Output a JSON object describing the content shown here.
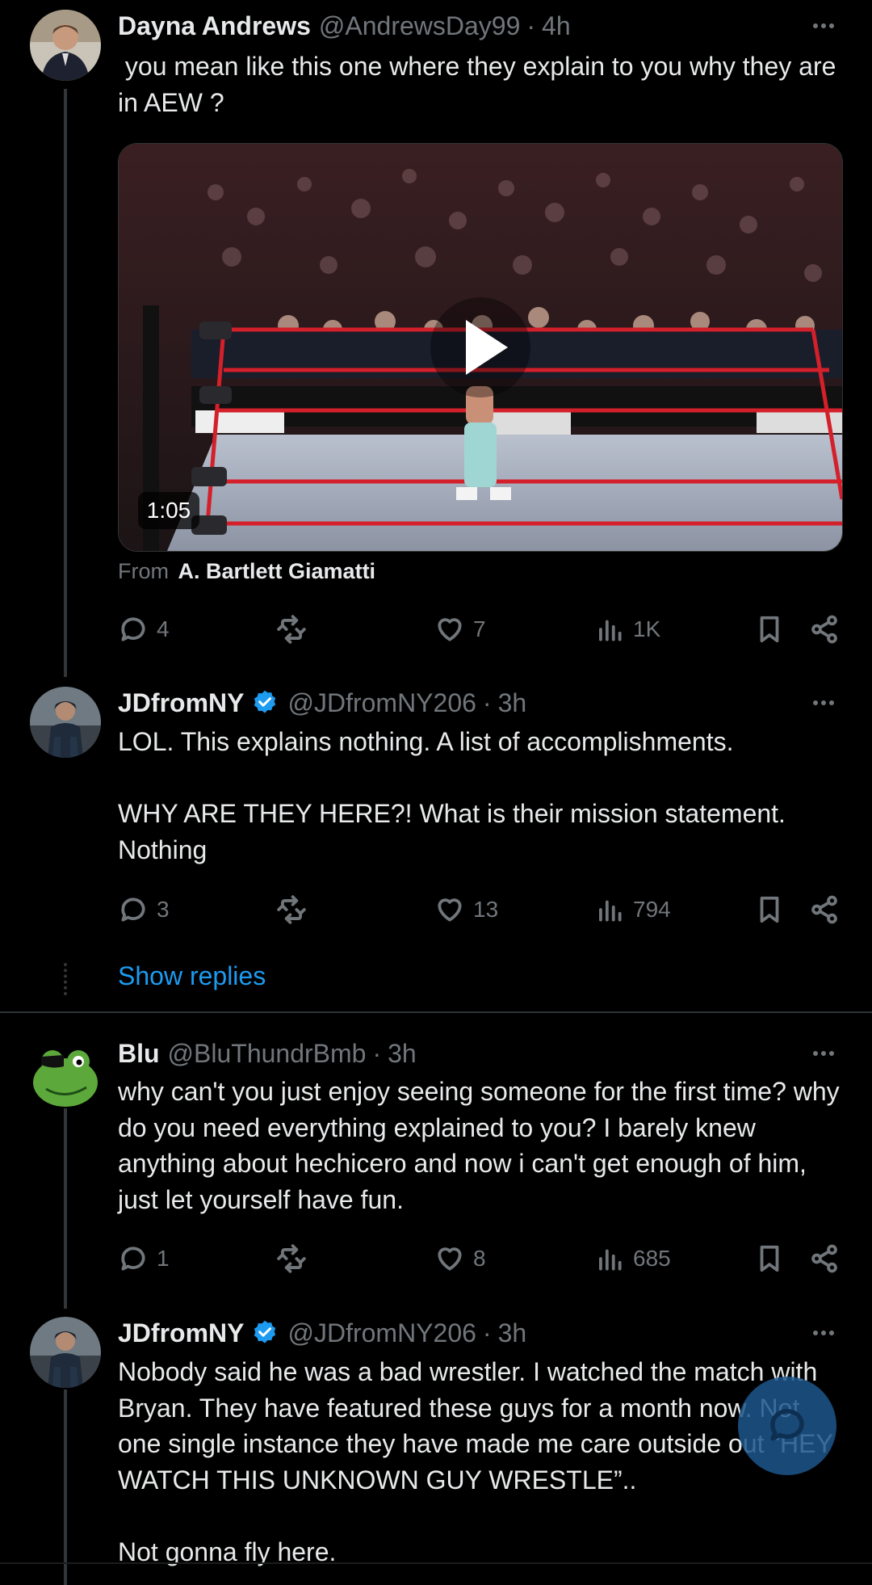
{
  "tweet1": {
    "name": "Dayna Andrews",
    "handle": "@AndrewsDay99",
    "time": "4h",
    "text": " you mean like this one where they explain to you why they are in AEW ?",
    "video": {
      "duration": "1:05"
    },
    "from_label": "From",
    "from_name": "A. Bartlett Giamatti",
    "stats": {
      "replies": "4",
      "likes": "7",
      "views": "1K"
    }
  },
  "tweet2": {
    "name": "JDfromNY",
    "handle": "@JDfromNY206",
    "time": "3h",
    "text": "LOL. This explains nothing. A list of accomplishments.\n\nWHY ARE THEY HERE?! What is their mission statement. Nothing",
    "stats": {
      "replies": "3",
      "likes": "13",
      "views": "794"
    }
  },
  "show_replies": "Show replies",
  "tweet3": {
    "name": "Blu",
    "handle": "@BluThundrBmb",
    "time": "3h",
    "text": "why can't you just enjoy seeing someone for the first time? why do you need everything explained to you? I barely knew anything about hechicero and now i can't get enough of him, just let yourself have fun.",
    "stats": {
      "replies": "1",
      "likes": "8",
      "views": "685"
    }
  },
  "tweet4": {
    "name": "JDfromNY",
    "handle": "@JDfromNY206",
    "time": "3h",
    "text": "Nobody said he was a bad wrestler. I watched the match with Bryan. They have featured these guys for a month now. Not one single instance they have made me care outside out “HEY WATCH THIS UNKNOWN GUY WRESTLE”..\n\nNot gonna fly here."
  },
  "colors": {
    "accent": "#1d9bf0",
    "muted": "#71767b",
    "text": "#e7e9ea",
    "background": "#000000"
  }
}
